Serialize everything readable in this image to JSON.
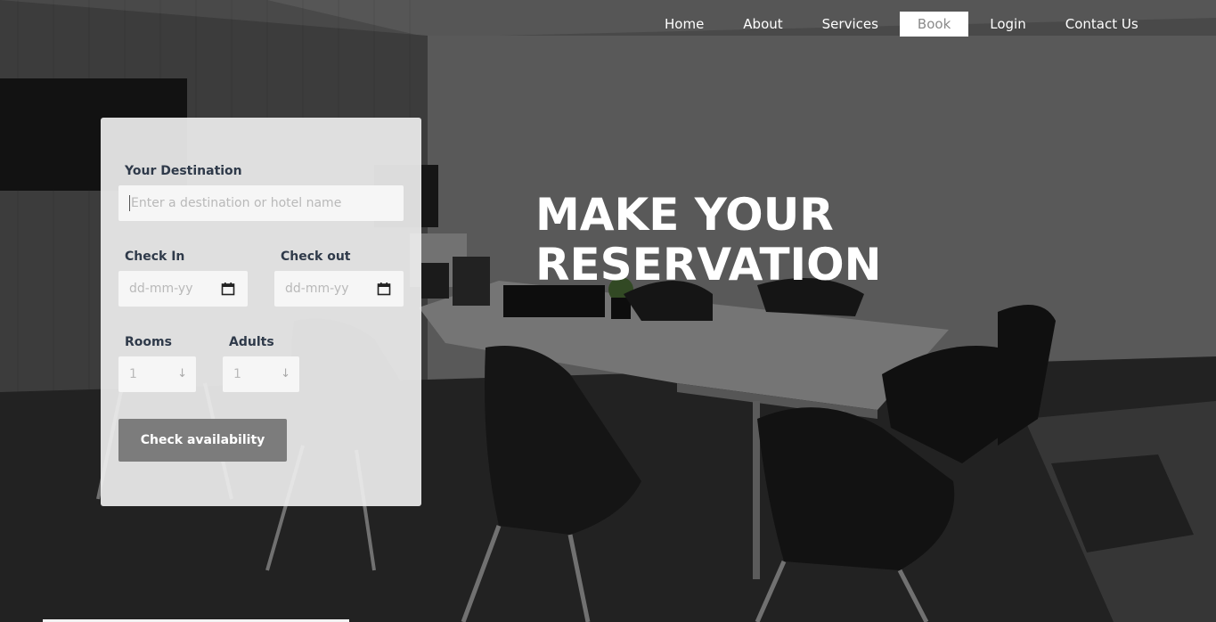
{
  "nav": {
    "items": [
      {
        "label": "Home"
      },
      {
        "label": "About"
      },
      {
        "label": "Services"
      },
      {
        "label": "Book",
        "active": true
      },
      {
        "label": "Login"
      },
      {
        "label": "Contact Us"
      }
    ]
  },
  "hero": {
    "line1": "MAKE YOUR",
    "line2": "RESERVATION"
  },
  "form": {
    "destination_label": "Your Destination",
    "destination_placeholder": "Enter a destination or hotel name",
    "checkin_label": "Check In",
    "checkin_placeholder": "dd-mm-yy",
    "checkout_label": "Check out",
    "checkout_placeholder": "dd-mm-yy",
    "rooms_label": "Rooms",
    "rooms_value": "1",
    "adults_label": "Adults",
    "adults_value": "1",
    "submit_label": "Check availability"
  },
  "icons": {
    "calendar": "calendar-icon",
    "select_arrow": "arrow-down-icon"
  },
  "colors": {
    "panel_bg": "#eeeeee",
    "button_bg": "#7c7c7c",
    "label_text": "#2f3a4a",
    "hero_text": "#ffffff"
  }
}
